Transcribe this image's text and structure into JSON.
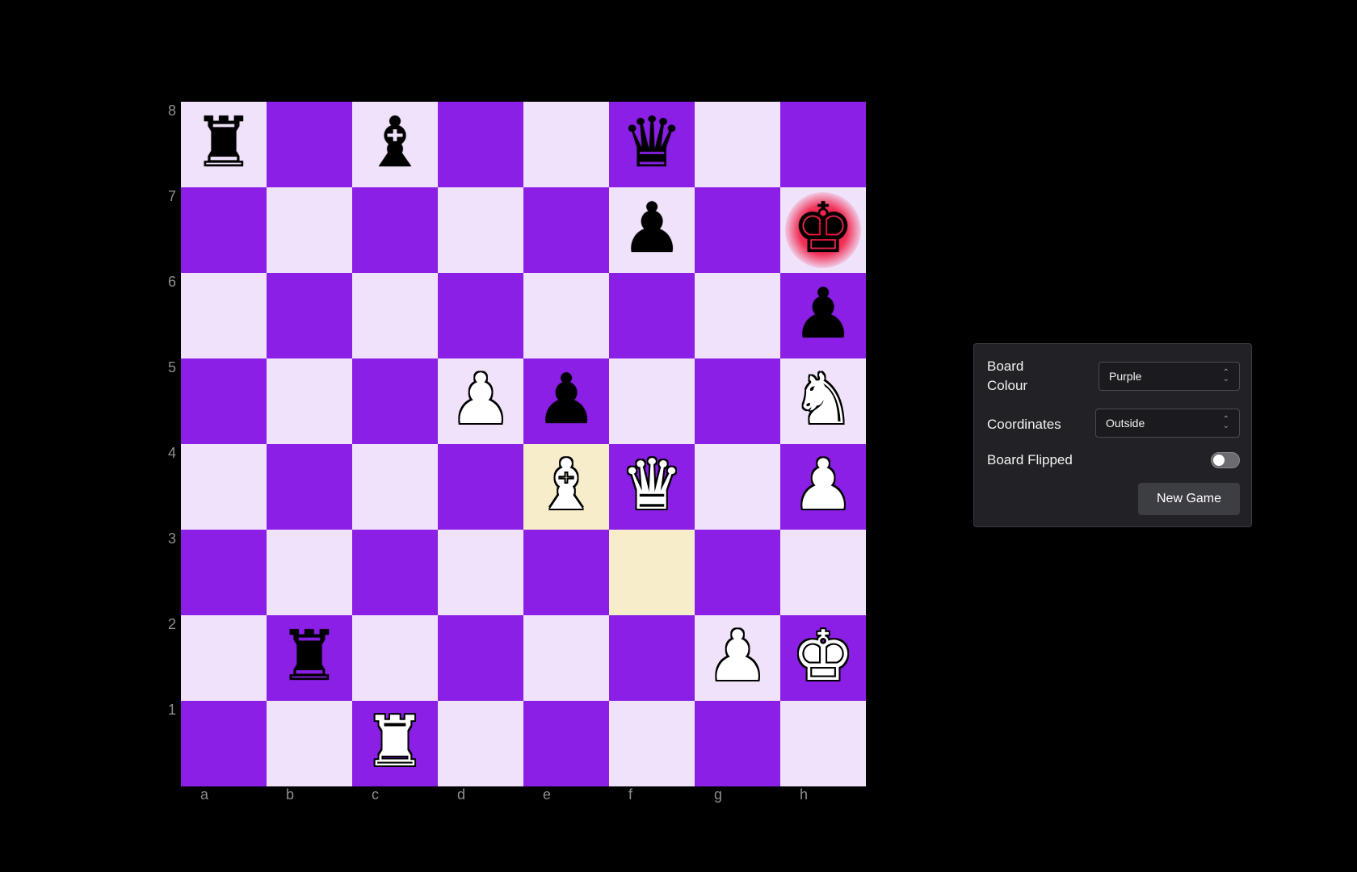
{
  "board": {
    "ranks": [
      "8",
      "7",
      "6",
      "5",
      "4",
      "3",
      "2",
      "1"
    ],
    "files": [
      "a",
      "b",
      "c",
      "d",
      "e",
      "f",
      "g",
      "h"
    ],
    "highlighted_squares": [
      "e4",
      "f3"
    ],
    "check_square": "h7",
    "light_color": "#f0e2fb",
    "dark_color": "#8b1fe6",
    "highlight_color": "#f7edcb",
    "pieces": [
      {
        "square": "a8",
        "color": "black",
        "type": "rook",
        "glyph": "♜"
      },
      {
        "square": "c8",
        "color": "black",
        "type": "bishop",
        "glyph": "♝"
      },
      {
        "square": "f8",
        "color": "black",
        "type": "queen",
        "glyph": "♛"
      },
      {
        "square": "f7",
        "color": "black",
        "type": "pawn",
        "glyph": "♟"
      },
      {
        "square": "h7",
        "color": "black",
        "type": "king",
        "glyph": "♚"
      },
      {
        "square": "h6",
        "color": "black",
        "type": "pawn",
        "glyph": "♟"
      },
      {
        "square": "d5",
        "color": "white",
        "type": "pawn",
        "glyph": "♟"
      },
      {
        "square": "e5",
        "color": "black",
        "type": "pawn",
        "glyph": "♟"
      },
      {
        "square": "h5",
        "color": "white",
        "type": "knight",
        "glyph": "♞"
      },
      {
        "square": "e4",
        "color": "white",
        "type": "bishop",
        "glyph": "♝"
      },
      {
        "square": "f4",
        "color": "white",
        "type": "queen",
        "glyph": "♛"
      },
      {
        "square": "h4",
        "color": "white",
        "type": "pawn",
        "glyph": "♟"
      },
      {
        "square": "b2",
        "color": "black",
        "type": "rook",
        "glyph": "♜"
      },
      {
        "square": "g2",
        "color": "white",
        "type": "pawn",
        "glyph": "♟"
      },
      {
        "square": "h2",
        "color": "white",
        "type": "king",
        "glyph": "♚"
      },
      {
        "square": "c1",
        "color": "white",
        "type": "rook",
        "glyph": "♜"
      }
    ]
  },
  "settings": {
    "board_colour_label": "Board Colour",
    "board_colour_value": "Purple",
    "coordinates_label": "Coordinates",
    "coordinates_value": "Outside",
    "board_flipped_label": "Board Flipped",
    "board_flipped": false,
    "new_game_label": "New Game"
  }
}
